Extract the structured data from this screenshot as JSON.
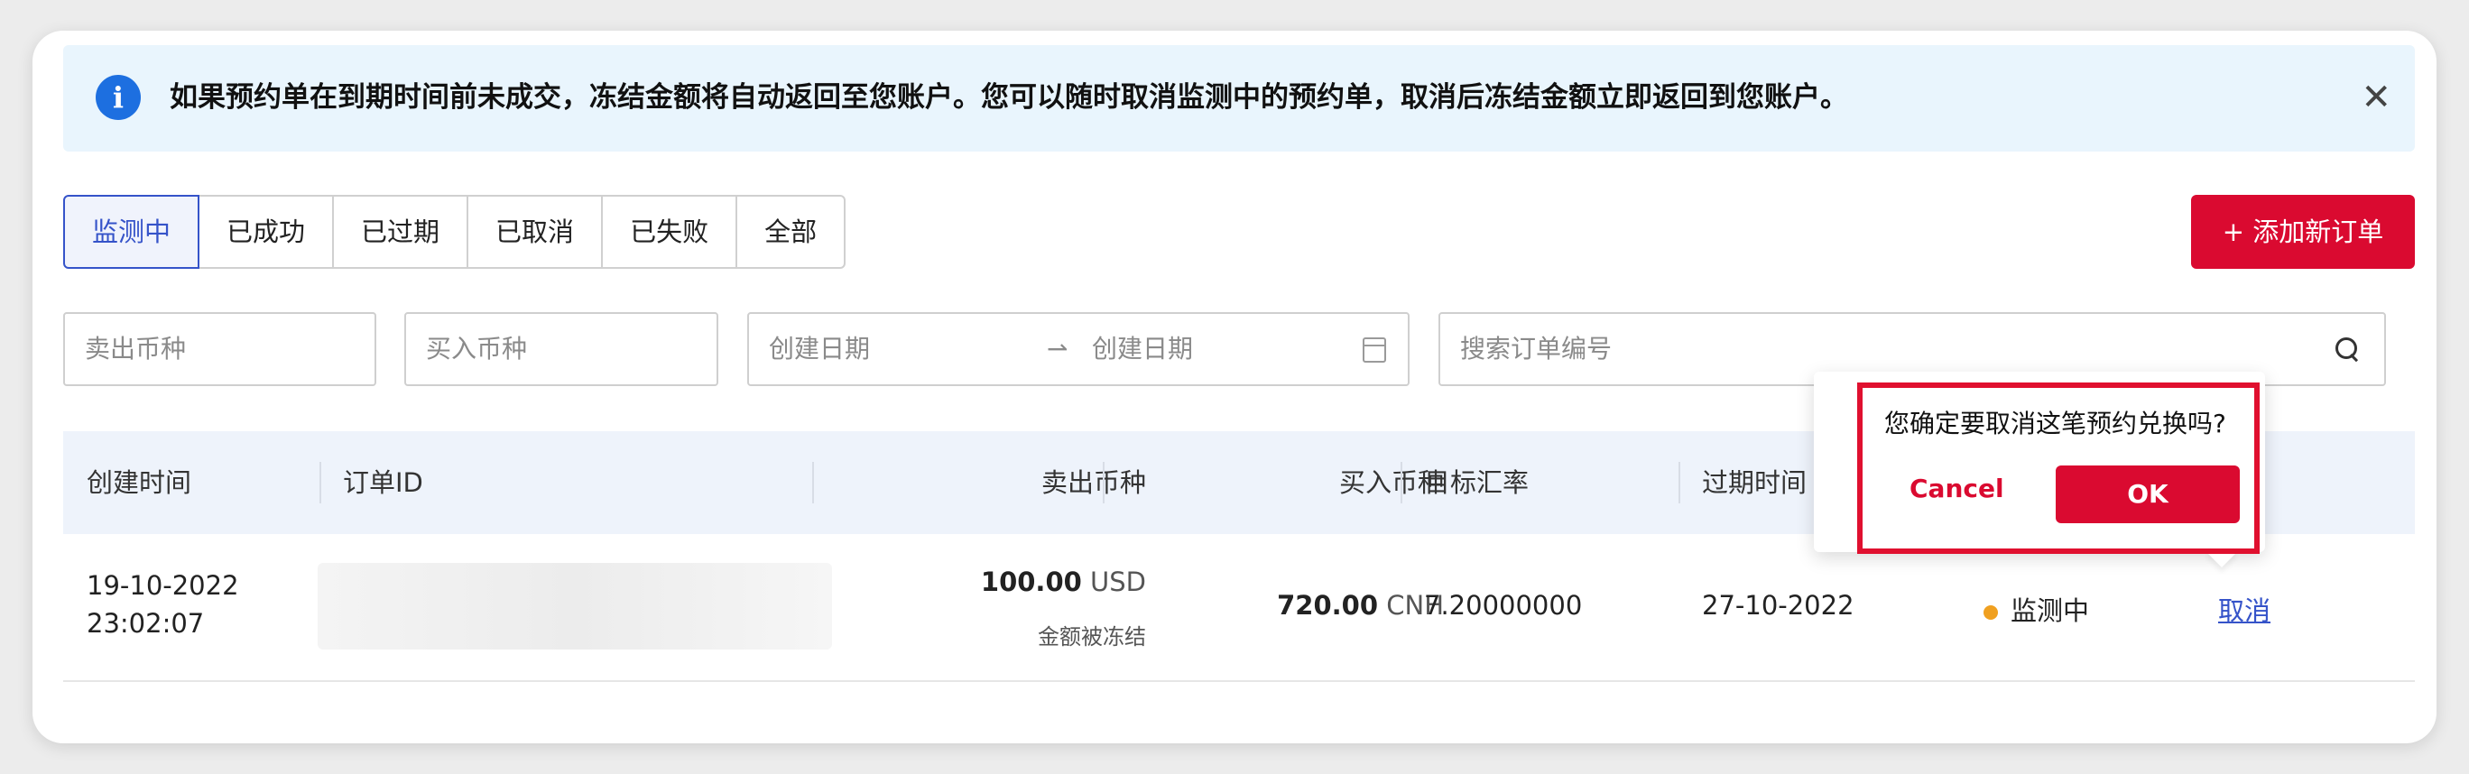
{
  "banner": {
    "info_icon": "info-icon",
    "text": "如果预约单在到期时间前未成交，冻结金额将自动返回至您账户。您可以随时取消监测中的预约单，取消后冻结金额立即返回到您账户。",
    "close_icon": "close-icon"
  },
  "tabs": [
    {
      "label": "监测中",
      "active": true
    },
    {
      "label": "已成功"
    },
    {
      "label": "已过期"
    },
    {
      "label": "已取消"
    },
    {
      "label": "已失败"
    },
    {
      "label": "全部"
    }
  ],
  "add_button": "+ 添加新订单",
  "filters": {
    "sell_currency_placeholder": "卖出币种",
    "buy_currency_placeholder": "买入币种",
    "start_date_placeholder": "创建日期",
    "date_separator": "⇀",
    "end_date_placeholder": "创建日期",
    "search_placeholder": "搜索订单编号"
  },
  "table": {
    "headers": [
      "创建时间",
      "订单ID",
      "卖出币种",
      "买入币种",
      "目标汇率",
      "过期时间"
    ],
    "rows": [
      {
        "created_date": "19-10-2022",
        "created_time": "23:02:07",
        "sell_amount": "100.00",
        "sell_currency": "USD",
        "sell_note": "金额被冻结",
        "buy_amount": "720.00",
        "buy_currency": "CNH",
        "target_rate": "7.20000000",
        "expiry": "27-10-2022",
        "status": "监测中",
        "status_color": "#f0a020",
        "action": "取消"
      }
    ]
  },
  "popover": {
    "question": "您确定要取消这笔预约兑换吗?",
    "cancel_label": "Cancel",
    "ok_label": "OK"
  },
  "colors": {
    "accent_red": "#da0a30",
    "highlight_border": "#e0102f",
    "tab_active": "#3553c9",
    "banner_bg": "#e9f5fd"
  }
}
